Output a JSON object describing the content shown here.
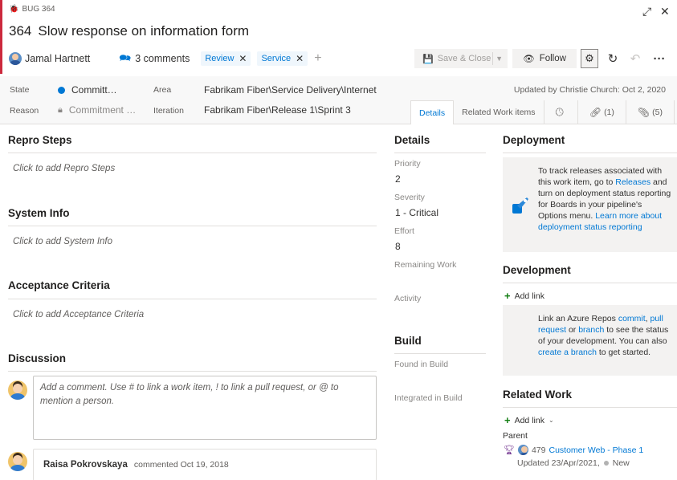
{
  "header": {
    "type_label": "BUG 364",
    "id": "364",
    "title": "Slow response on information form",
    "assignee": "Jamal Hartnett",
    "comments_count": "3 comments",
    "tags": [
      {
        "label": "Review"
      },
      {
        "label": "Service"
      }
    ],
    "tag_add": "+",
    "save_close_label": "Save & Close",
    "follow_label": "Follow"
  },
  "meta": {
    "state_label": "State",
    "state_value": "Committ…",
    "reason_label": "Reason",
    "reason_value": "Commitment …",
    "area_label": "Area",
    "area_value": "Fabrikam Fiber\\Service Delivery\\Internet",
    "iteration_label": "Iteration",
    "iteration_value": "Fabrikam Fiber\\Release 1\\Sprint 3",
    "updated": "Updated by Christie Church: Oct 2, 2020",
    "state_color": "#0078d4"
  },
  "tabs": [
    {
      "label": "Details"
    },
    {
      "label": "Related Work items"
    },
    {
      "label": ""
    },
    {
      "label": "(1)"
    },
    {
      "label": "(5)"
    }
  ],
  "left": {
    "repro_title": "Repro Steps",
    "repro_placeholder": "Click to add Repro Steps",
    "sysinfo_title": "System Info",
    "sysinfo_placeholder": "Click to add System Info",
    "acceptance_title": "Acceptance Criteria",
    "acceptance_placeholder": "Click to add Acceptance Criteria",
    "discussion_title": "Discussion",
    "comment_placeholder": "Add a comment. Use # to link a work item, ! to link a pull request, or @ to mention a person.",
    "comment_author": "Raisa Pokrovskaya",
    "comment_date": "commented Oct 19, 2018"
  },
  "details": {
    "title": "Details",
    "priority_label": "Priority",
    "priority_value": "2",
    "severity_label": "Severity",
    "severity_value": "1 - Critical",
    "effort_label": "Effort",
    "effort_value": "8",
    "remaining_label": "Remaining Work",
    "activity_label": "Activity",
    "build_title": "Build",
    "found_label": "Found in Build",
    "integrated_label": "Integrated in Build"
  },
  "deployment": {
    "title": "Deployment",
    "text_1": "To track releases associated with this work item, go to ",
    "link_releases": "Releases",
    "text_2": " and turn on deployment status reporting for Boards in your pipeline's Options menu. ",
    "link_learn": "Learn more about deployment status reporting"
  },
  "development": {
    "title": "Development",
    "add_link": "Add link",
    "text_1": "Link an Azure Repos ",
    "link_commit": "commit",
    "text_2": ", ",
    "link_pr": "pull request",
    "text_3": " or ",
    "link_branch": "branch",
    "text_4": " to see the status of your development. You can also ",
    "link_create_branch": "create a branch",
    "text_5": " to get started."
  },
  "related": {
    "title": "Related Work",
    "add_link": "Add link",
    "parent_label": "Parent",
    "parent_id": "479",
    "parent_title": "Customer Web - Phase 1",
    "parent_updated": "Updated 23/Apr/2021,",
    "parent_state": "New"
  }
}
